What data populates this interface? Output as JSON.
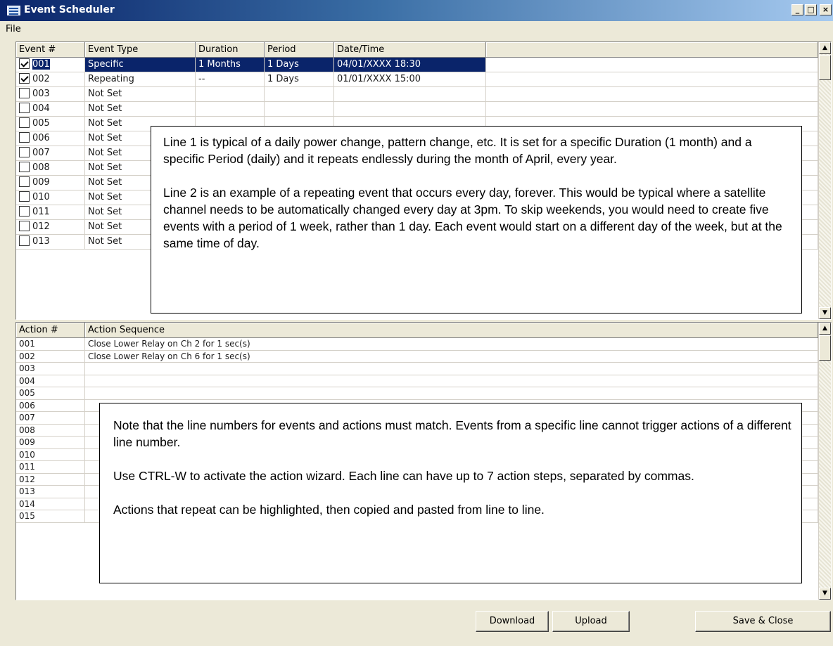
{
  "window": {
    "title": "Event Scheduler",
    "controls": {
      "minimize": "_",
      "maximize": "□",
      "close": "×"
    }
  },
  "menu": {
    "file": "File"
  },
  "events": {
    "headers": {
      "num": "Event #",
      "type": "Event Type",
      "duration": "Duration",
      "period": "Period",
      "datetime": "Date/Time"
    },
    "rows": [
      {
        "checked": true,
        "num": "001",
        "type": "Specific",
        "duration": "1 Months",
        "period": "1 Days",
        "datetime": "04/01/XXXX 18:30",
        "selected": true
      },
      {
        "checked": true,
        "num": "002",
        "type": "Repeating",
        "duration": "--",
        "period": "1 Days",
        "datetime": "01/01/XXXX 15:00"
      },
      {
        "checked": false,
        "num": "003",
        "type": "Not Set",
        "duration": "",
        "period": "",
        "datetime": ""
      },
      {
        "checked": false,
        "num": "004",
        "type": "Not Set",
        "duration": "",
        "period": "",
        "datetime": ""
      },
      {
        "checked": false,
        "num": "005",
        "type": "Not Set",
        "duration": "",
        "period": "",
        "datetime": ""
      },
      {
        "checked": false,
        "num": "006",
        "type": "Not Set",
        "duration": "",
        "period": "",
        "datetime": ""
      },
      {
        "checked": false,
        "num": "007",
        "type": "Not Set",
        "duration": "",
        "period": "",
        "datetime": ""
      },
      {
        "checked": false,
        "num": "008",
        "type": "Not Set",
        "duration": "",
        "period": "",
        "datetime": ""
      },
      {
        "checked": false,
        "num": "009",
        "type": "Not Set",
        "duration": "",
        "period": "",
        "datetime": ""
      },
      {
        "checked": false,
        "num": "010",
        "type": "Not Set",
        "duration": "",
        "period": "",
        "datetime": ""
      },
      {
        "checked": false,
        "num": "011",
        "type": "Not Set",
        "duration": "",
        "period": "",
        "datetime": ""
      },
      {
        "checked": false,
        "num": "012",
        "type": "Not Set",
        "duration": "",
        "period": "",
        "datetime": ""
      },
      {
        "checked": false,
        "num": "013",
        "type": "Not Set",
        "duration": "",
        "period": "",
        "datetime": ""
      }
    ]
  },
  "actions": {
    "headers": {
      "num": "Action #",
      "sequence": "Action Sequence"
    },
    "rows": [
      {
        "num": "001",
        "sequence": "Close Lower Relay on Ch 2 for 1 sec(s)"
      },
      {
        "num": "002",
        "sequence": "Close Lower Relay on Ch 6 for 1 sec(s)"
      },
      {
        "num": "003",
        "sequence": ""
      },
      {
        "num": "004",
        "sequence": ""
      },
      {
        "num": "005",
        "sequence": ""
      },
      {
        "num": "006",
        "sequence": ""
      },
      {
        "num": "007",
        "sequence": ""
      },
      {
        "num": "008",
        "sequence": ""
      },
      {
        "num": "009",
        "sequence": ""
      },
      {
        "num": "010",
        "sequence": ""
      },
      {
        "num": "011",
        "sequence": ""
      },
      {
        "num": "012",
        "sequence": ""
      },
      {
        "num": "013",
        "sequence": ""
      },
      {
        "num": "014",
        "sequence": ""
      },
      {
        "num": "015",
        "sequence": ""
      }
    ]
  },
  "callout_events": [
    "Line 1 is typical of a daily power change, pattern change, etc.  It is set for a specific Duration (1 month) and a specific Period (daily) and it repeats endlessly during the month of April, every year.",
    "Line 2 is an example of a repeating event that occurs every day, forever.  This would be typical where a satellite channel needs to be automatically changed every day at 3pm.  To skip weekends, you would need to create five events with a period of 1 week, rather than 1 day.  Each event would start on a different day of the week, but at the same time of day."
  ],
  "callout_actions": [
    "Note that the line numbers for events and actions must match.  Events from a specific line cannot trigger actions of a different line number.",
    "Use CTRL-W to activate the action wizard.  Each line can have up to 7 action steps, separated by commas.",
    "Actions that repeat can be highlighted, then copied and pasted from line to line."
  ],
  "buttons": {
    "download": "Download",
    "upload": "Upload",
    "save_close": "Save & Close"
  },
  "scroll_arrows": {
    "up": "▲",
    "down": "▼"
  },
  "colors": {
    "selection": "#0a246a",
    "titlebar_start": "#0a246a",
    "titlebar_end": "#a6caf0",
    "window_bg": "#ece9d8"
  },
  "icons": {
    "app": "scheduler-window-icon",
    "checkbox": "checkbox-icon"
  }
}
